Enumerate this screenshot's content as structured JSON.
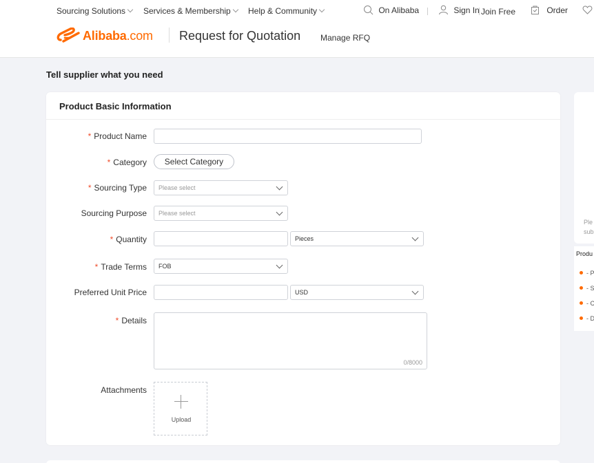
{
  "topnav": {
    "sourcing": "Sourcing Solutions",
    "services": "Services & Membership",
    "help": "Help & Community",
    "on_alibaba": "On Alibaba",
    "sign_in": "Sign In",
    "join": "Join Free",
    "order": "Order"
  },
  "brand": {
    "logo_text": "Alibaba",
    "logo_suffix": ".com",
    "page_title": "Request for Quotation",
    "manage": "Manage RFQ",
    "accent": "#ff6a00"
  },
  "page": {
    "heading": "Tell supplier what you need"
  },
  "form": {
    "section_title": "Product Basic Information",
    "required_mark": "*",
    "product_name": {
      "label": "Product Name",
      "value": ""
    },
    "category": {
      "label": "Category",
      "button": "Select Category"
    },
    "sourcing_type": {
      "label": "Sourcing Type",
      "placeholder": "Please select"
    },
    "sourcing_purpose": {
      "label": "Sourcing Purpose",
      "placeholder": "Please select"
    },
    "quantity": {
      "label": "Quantity",
      "value": "",
      "unit": "Pieces"
    },
    "trade_terms": {
      "label": "Trade Terms",
      "value": "FOB"
    },
    "unit_price": {
      "label": "Preferred Unit Price",
      "value": "",
      "currency": "USD"
    },
    "details": {
      "label": "Details",
      "value": "",
      "counter": "0/8000"
    },
    "attachments": {
      "label": "Attachments",
      "upload": "Upload"
    }
  },
  "side": {
    "hint_1": "Ple",
    "hint_2": "sub",
    "heading": "Produ",
    "items": [
      "- P",
      "- S",
      "- C",
      "- D"
    ]
  }
}
